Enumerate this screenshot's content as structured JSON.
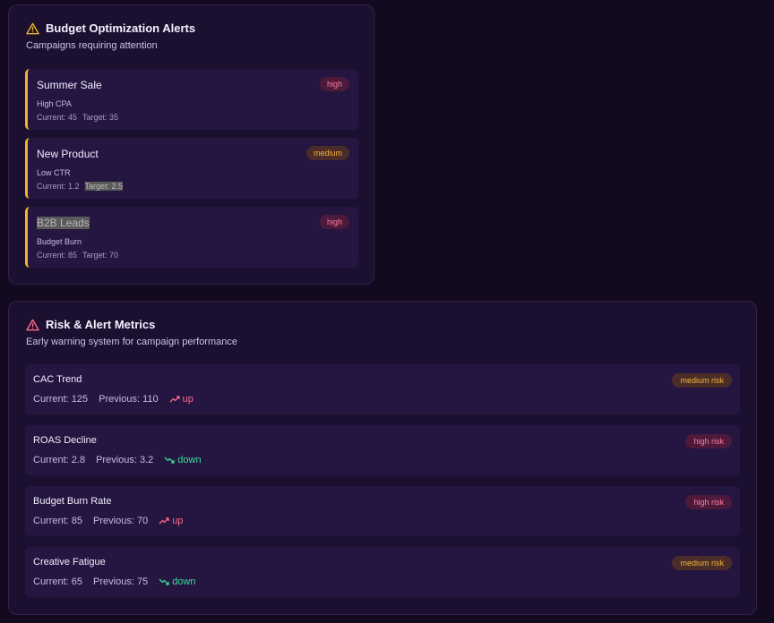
{
  "budget": {
    "title": "Budget Optimization Alerts",
    "subtitle": "Campaigns requiring attention",
    "icon": "warning-icon",
    "icon_color": "#f0b429",
    "alerts": [
      {
        "name": "Summer Sale",
        "issue": "High CPA",
        "current": "Current: 45",
        "target": "Target: 35",
        "severity": "high"
      },
      {
        "name": "New Product",
        "issue": "Low CTR",
        "current": "Current: 1.2",
        "target": "Target: 2.5",
        "severity": "medium"
      },
      {
        "name": "B2B Leads",
        "issue": "Budget Burn",
        "current": "Current: 85",
        "target": "Target: 70",
        "severity": "high"
      }
    ]
  },
  "risk": {
    "title": "Risk & Alert Metrics",
    "subtitle": "Early warning system for campaign performance",
    "icon": "warning-icon",
    "icon_color": "#ff6b8d",
    "metrics": [
      {
        "name": "CAC Trend",
        "current": "Current: 125",
        "previous": "Previous: 110",
        "trend": "up",
        "risk": "medium risk"
      },
      {
        "name": "ROAS Decline",
        "current": "Current: 2.8",
        "previous": "Previous: 3.2",
        "trend": "down",
        "risk": "high risk"
      },
      {
        "name": "Budget Burn Rate",
        "current": "Current: 85",
        "previous": "Previous: 70",
        "trend": "up",
        "risk": "high risk"
      },
      {
        "name": "Creative Fatigue",
        "current": "Current: 65",
        "previous": "Previous: 75",
        "trend": "down",
        "risk": "medium risk"
      }
    ]
  },
  "colors": {
    "accent_warning": "#f0b429",
    "high": "#ff7fa6",
    "medium": "#f6b23a",
    "trend_up": "#ff6b8d",
    "trend_down": "#3ddc97"
  }
}
